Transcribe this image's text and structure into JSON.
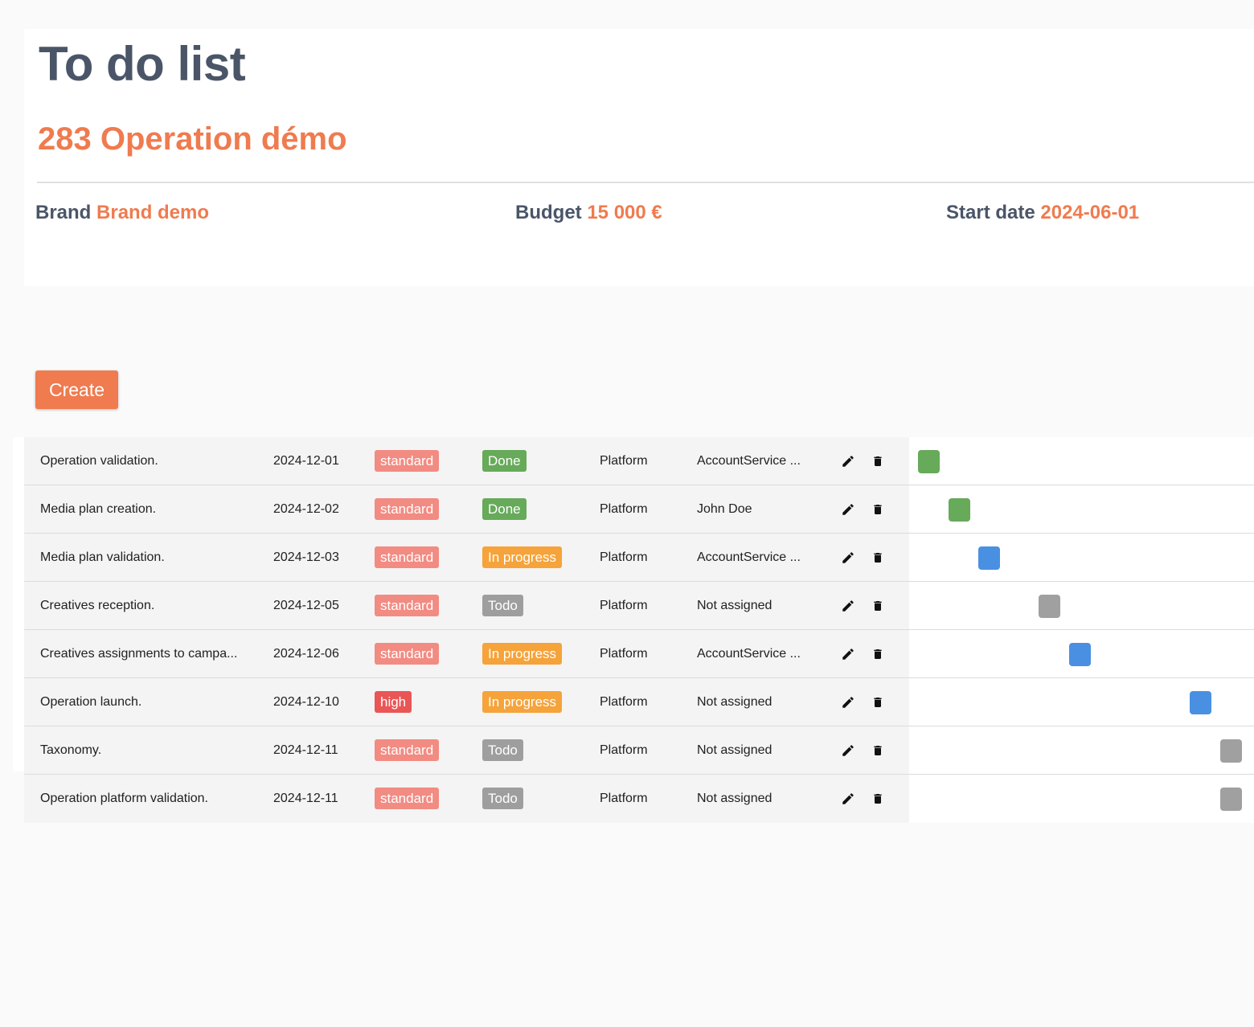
{
  "header": {
    "title": "To do list",
    "operation": "283 Operation démo",
    "brand_label": "Brand",
    "brand_value": "Brand demo",
    "budget_label": "Budget",
    "budget_value": "15 000 €",
    "start_label": "Start date",
    "start_value": "2024-06-01"
  },
  "toolbar": {
    "create_label": "Create"
  },
  "colors": {
    "accent": "#ef7b4f",
    "title": "#4a5568",
    "priority_standard": "#f28b82",
    "priority_high": "#ea5555",
    "status_done": "#66aa5a",
    "status_in_progress": "#f5a33a",
    "status_todo": "#9e9e9e",
    "gantt_done": "#66aa5a",
    "gantt_in_progress": "#4a90e2",
    "gantt_todo": "#a0a0a0"
  },
  "icons": {
    "edit": "pencil-icon",
    "delete": "trash-icon"
  },
  "tasks": [
    {
      "name": "Operation validation.",
      "date": "2024-12-01",
      "priority": "standard",
      "status": "Done",
      "platform": "Platform",
      "assignee": "AccountService ..."
    },
    {
      "name": "Media plan creation.",
      "date": "2024-12-02",
      "priority": "standard",
      "status": "Done",
      "platform": "Platform",
      "assignee": "John Doe"
    },
    {
      "name": "Media plan validation.",
      "date": "2024-12-03",
      "priority": "standard",
      "status": "In progress",
      "platform": "Platform",
      "assignee": "AccountService ..."
    },
    {
      "name": "Creatives reception.",
      "date": "2024-12-05",
      "priority": "standard",
      "status": "Todo",
      "platform": "Platform",
      "assignee": "Not assigned"
    },
    {
      "name": "Creatives assignments to campa...",
      "date": "2024-12-06",
      "priority": "standard",
      "status": "In progress",
      "platform": "Platform",
      "assignee": "AccountService ..."
    },
    {
      "name": "Operation launch.",
      "date": "2024-12-10",
      "priority": "high",
      "status": "In progress",
      "platform": "Platform",
      "assignee": "Not assigned"
    },
    {
      "name": "Taxonomy.",
      "date": "2024-12-11",
      "priority": "standard",
      "status": "Todo",
      "platform": "Platform",
      "assignee": "Not assigned"
    },
    {
      "name": "Operation platform validation.",
      "date": "2024-12-11",
      "priority": "standard",
      "status": "Todo",
      "platform": "Platform",
      "assignee": "Not assigned"
    }
  ]
}
